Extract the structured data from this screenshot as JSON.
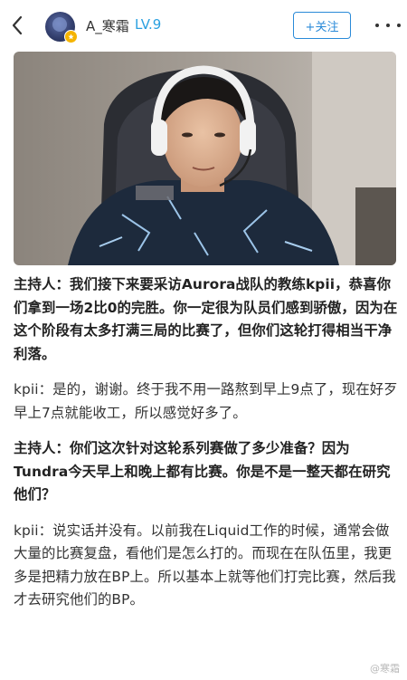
{
  "header": {
    "username": "A_寒霜",
    "level": "LV.9",
    "follow_label": "+关注",
    "back_icon": "chevron-left-icon",
    "more_icon": "more-dots-icon"
  },
  "article": {
    "paragraphs": [
      {
        "text": "主持人：我们接下来要采访Aurora战队的教练kpii，恭喜你们拿到一场2比0的完胜。你一定很为队员们感到骄傲，因为在这个阶段有太多打满三局的比赛了，但你们这轮打得相当干净利落。",
        "bold": true
      },
      {
        "text": "kpii：是的，谢谢。终于我不用一路熬到早上9点了，现在好歹早上7点就能收工，所以感觉好多了。",
        "bold": false
      },
      {
        "text": "主持人：你们这次针对这轮系列赛做了多少准备？因为Tundra今天早上和晚上都有比赛。你是不是一整天都在研究他们？",
        "bold": true
      },
      {
        "text": "kpii：说实话并没有。以前我在Liquid工作的时候，通常会做大量的比赛复盘，看他们是怎么打的。而现在在队伍里，我更多是把精力放在BP上。所以基本上就等他们打完比赛，然后我才去研究他们的BP。",
        "bold": false
      }
    ]
  },
  "watermark": "@寒霜",
  "colors": {
    "accent_blue": "#2a8ad8",
    "level_blue": "#2aa0e0",
    "vip_badge": "#f5b400"
  }
}
